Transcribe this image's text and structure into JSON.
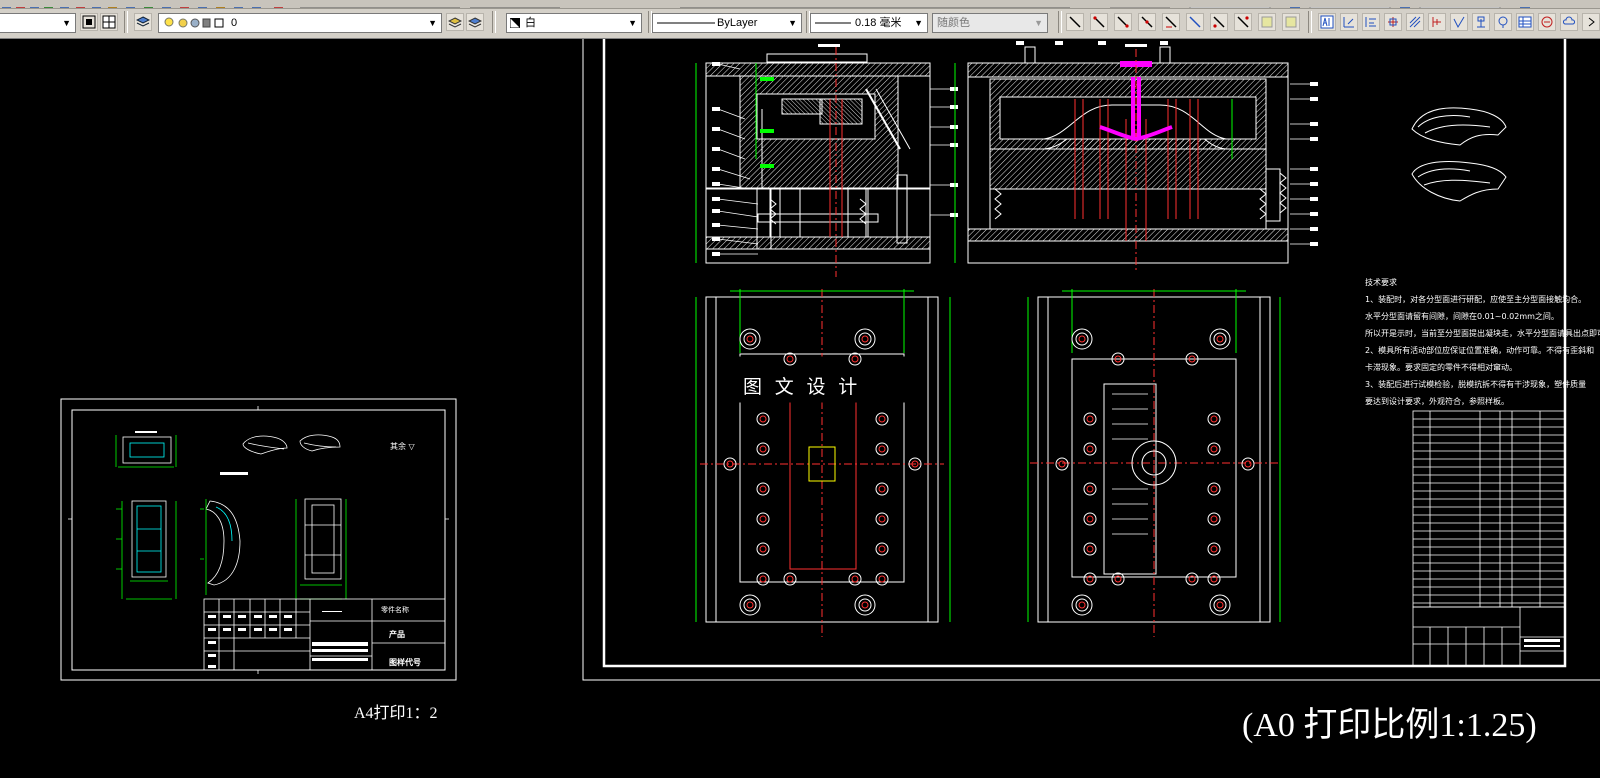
{
  "toolbar": {
    "layer_name": "0",
    "color_value": "白",
    "linetype_value": "ByLayer",
    "lineweight_value": "0.18 毫米",
    "plotstyle_value": "随颜色"
  },
  "drawing": {
    "a0_watermark": "图 文 设 计",
    "a0_tech_title": "技术要求",
    "a0_tech_lines": [
      "1、装配时，对各分型面进行研配，应使至主分型面接触均合。",
      "水平分型面请留有间隙，间隙在0.01~0.02mm之间。",
      "所以开是示时，当前至分型面提出凝块走，水平分型面请具出点即可。",
      "2、模具所有活动部位应保证位置准确，动作可靠。不得有歪斜和",
      "卡滞现象。要求固定的零件不得相对窜动。",
      "3、装配后进行试模检验，脱模抗拆不得有干涉现象，塑件质量",
      "要达到设计要求，外观符合，参照样板。"
    ],
    "a4_surface_note": "其余 ▽",
    "a4_title_block": {
      "name_label": "零件名称",
      "product_label": "产品",
      "code_label": "图样代号"
    },
    "caption_a4": "A4打印1：2",
    "caption_a0": "(A0 打印比例1:1.25)"
  },
  "colors": {
    "background": "#000000",
    "lines": "#ffffff",
    "dimensions": "#00ff00",
    "sprue": "#ff00ff",
    "red_lines": "#ff3030",
    "yellow": "#ffff00",
    "cyan": "#00ffff"
  }
}
